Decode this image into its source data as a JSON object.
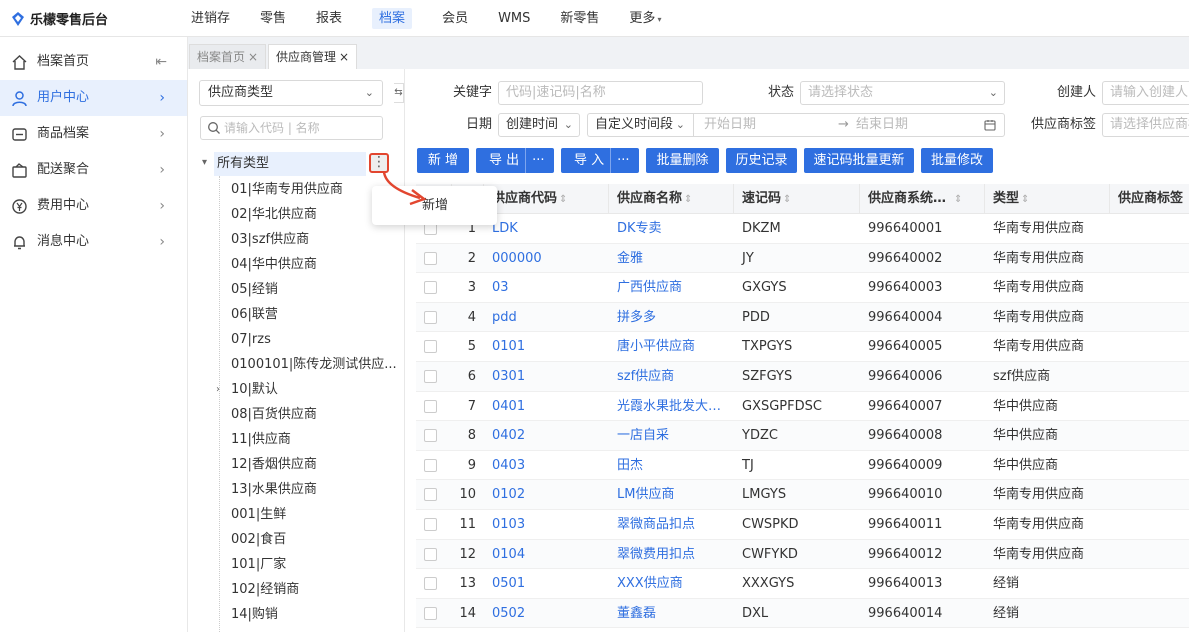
{
  "app": {
    "title": "乐檬零售后台"
  },
  "topnav": [
    {
      "label": "进销存"
    },
    {
      "label": "零售"
    },
    {
      "label": "报表"
    },
    {
      "label": "档案",
      "active": true
    },
    {
      "label": "会员"
    },
    {
      "label": "WMS"
    },
    {
      "label": "新零售"
    },
    {
      "label": "更多"
    }
  ],
  "sidebar": {
    "items": [
      {
        "label": "档案首页",
        "icon": "home-icon"
      },
      {
        "label": "用户中心",
        "icon": "user-icon",
        "active": true
      },
      {
        "label": "商品档案",
        "icon": "goods-icon"
      },
      {
        "label": "配送聚合",
        "icon": "delivery-icon"
      },
      {
        "label": "费用中心",
        "icon": "yen-icon"
      },
      {
        "label": "消息中心",
        "icon": "bell-icon"
      }
    ]
  },
  "tabs": [
    {
      "label": "档案首页"
    },
    {
      "label": "供应商管理",
      "active": true
    }
  ],
  "tree": {
    "type_select": "供应商类型",
    "search_placeholder": "请输入代码 | 名称",
    "root": "所有类型",
    "nodes": [
      "01|华南专用供应商",
      "02|华北供应商",
      "03|szf供应商",
      "04|华中供应商",
      "05|经销",
      "06|联营",
      "07|rzs",
      "0100101|陈传龙测试供应...",
      "10|默认",
      "08|百货供应商",
      "11|供应商",
      "12|香烟供应商",
      "13|水果供应商",
      "001|生鲜",
      "002|食百",
      "101|厂家",
      "102|经销商",
      "14|购销"
    ],
    "popup_add": "新增"
  },
  "filters": {
    "keyword_label": "关键字",
    "keyword_placeholder": "代码|速记码|名称",
    "status_label": "状态",
    "status_placeholder": "请选择状态",
    "creator_label": "创建人",
    "creator_placeholder": "请输入创建人",
    "date_label": "日期",
    "date_type": "创建时间",
    "date_range_type": "自定义时间段",
    "start_placeholder": "开始日期",
    "range_arrow": "→",
    "end_placeholder": "结束日期",
    "tag_label": "供应商标签",
    "tag_placeholder": "请选择供应商标签"
  },
  "toolbar": {
    "add": "新 增",
    "export": "导 出",
    "import": "导 入",
    "more": "···",
    "batch_delete": "批量删除",
    "history": "历史记录",
    "batch_update_code": "速记码批量更新",
    "batch_edit": "批量修改"
  },
  "table": {
    "headers": [
      "供应商代码",
      "供应商名称",
      "速记码",
      "供应商系统…",
      "类型",
      "供应商标签"
    ],
    "rows": [
      [
        "1",
        "LDK",
        "DK专卖",
        "DKZM",
        "996640001",
        "华南专用供应商"
      ],
      [
        "2",
        "000000",
        "金雅",
        "JY",
        "996640002",
        "华南专用供应商"
      ],
      [
        "3",
        "03",
        "广西供应商",
        "GXGYS",
        "996640003",
        "华南专用供应商"
      ],
      [
        "4",
        "pdd",
        "拼多多",
        "PDD",
        "996640004",
        "华南专用供应商"
      ],
      [
        "5",
        "0101",
        "唐小平供应商",
        "TXPGYS",
        "996640005",
        "华南专用供应商"
      ],
      [
        "6",
        "0301",
        "szf供应商",
        "SZFGYS",
        "996640006",
        "szf供应商"
      ],
      [
        "7",
        "0401",
        "光霞水果批发大…",
        "GXSGPFDSC",
        "996640007",
        "华中供应商"
      ],
      [
        "8",
        "0402",
        "一店自采",
        "YDZC",
        "996640008",
        "华中供应商"
      ],
      [
        "9",
        "0403",
        "田杰",
        "TJ",
        "996640009",
        "华中供应商"
      ],
      [
        "10",
        "0102",
        "LM供应商",
        "LMGYS",
        "996640010",
        "华南专用供应商"
      ],
      [
        "11",
        "0103",
        "翠微商品扣点",
        "CWSPKD",
        "996640011",
        "华南专用供应商"
      ],
      [
        "12",
        "0104",
        "翠微费用扣点",
        "CWFYKD",
        "996640012",
        "华南专用供应商"
      ],
      [
        "13",
        "0501",
        "XXX供应商",
        "XXXGYS",
        "996640013",
        "经销"
      ],
      [
        "14",
        "0502",
        "董鑫磊",
        "DXL",
        "996640014",
        "经销"
      ]
    ]
  },
  "colors": {
    "primary": "#2f6fe0",
    "highlight": "#e2462f"
  }
}
